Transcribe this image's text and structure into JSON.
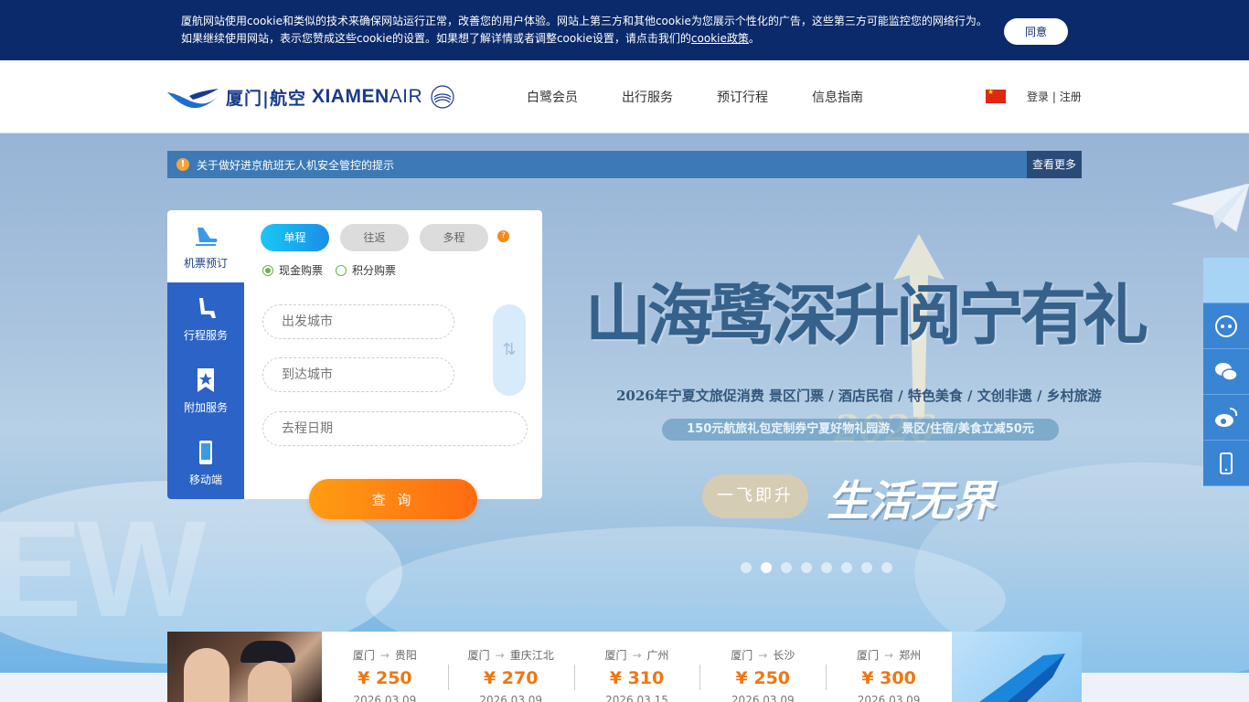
{
  "cookie": {
    "text": "厦航网站使用cookie和类似的技术来确保网站运行正常，改善您的用户体验。网站上第三方和其他cookie为您展示个性化的广告，这些第三方可能监控您的网络行为。如果继续使用网站，表示您赞成这些cookie的设置。如果想了解详情或者调整cookie设置，请点击我们的",
    "link": "cookie政策",
    "period": "。",
    "agree": "同意"
  },
  "header": {
    "logo_cn": "厦门|航空",
    "logo_en_bold": "XIAMEN",
    "logo_en_thin": "AIR",
    "nav": [
      "白鹭会员",
      "出行服务",
      "预订行程",
      "信息指南"
    ],
    "login": "登录",
    "divider": "|",
    "register": "注册"
  },
  "notice": {
    "icon": "!",
    "text": "关于做好进京航班无人机安全管控的提示",
    "more": "查看更多"
  },
  "hero": {
    "title": "山海鹭深升阅宁有礼",
    "subtitle": "2026年宁夏文旅促消费 景区门票 / 酒店民宿 / 特色美食 / 文创非遗 / 乡村旅游",
    "pill": "150元航旅礼包定制券宁夏好物礼园游、景区/住宿/美食立减50元",
    "year": "2026",
    "fly": "一飞即升",
    "slogan": "生活无界",
    "big_letters": "EW",
    "dot_count": 8,
    "active_dot": 1
  },
  "booking": {
    "tabs": [
      "机票预订",
      "行程服务",
      "附加服务",
      "移动端"
    ],
    "trip_types": [
      "单程",
      "往返",
      "多程"
    ],
    "help": "?",
    "pay_types": [
      "现金购票",
      "积分购票"
    ],
    "from_placeholder": "出发城市",
    "to_placeholder": "到达城市",
    "date_placeholder": "去程日期",
    "swap": "⇅",
    "search": "查 询"
  },
  "deals": [
    {
      "from": "厦门",
      "to": "贵阳",
      "price": "¥ 250",
      "date": "2026.03.09"
    },
    {
      "from": "厦门",
      "to": "重庆江北",
      "price": "¥ 270",
      "date": "2026.03.09"
    },
    {
      "from": "厦门",
      "to": "广州",
      "price": "¥ 310",
      "date": "2026.03.15"
    },
    {
      "from": "厦门",
      "to": "长沙",
      "price": "¥ 250",
      "date": "2026.03.09"
    },
    {
      "from": "厦门",
      "to": "郑州",
      "price": "¥ 300",
      "date": "2026.03.09"
    }
  ],
  "deal_arrow": "→",
  "colors": {
    "brand_navy": "#0b2a6b",
    "brand_blue": "#2b63c6",
    "accent_orange": "#f2760f",
    "trip_active": "#1a8ee8"
  }
}
